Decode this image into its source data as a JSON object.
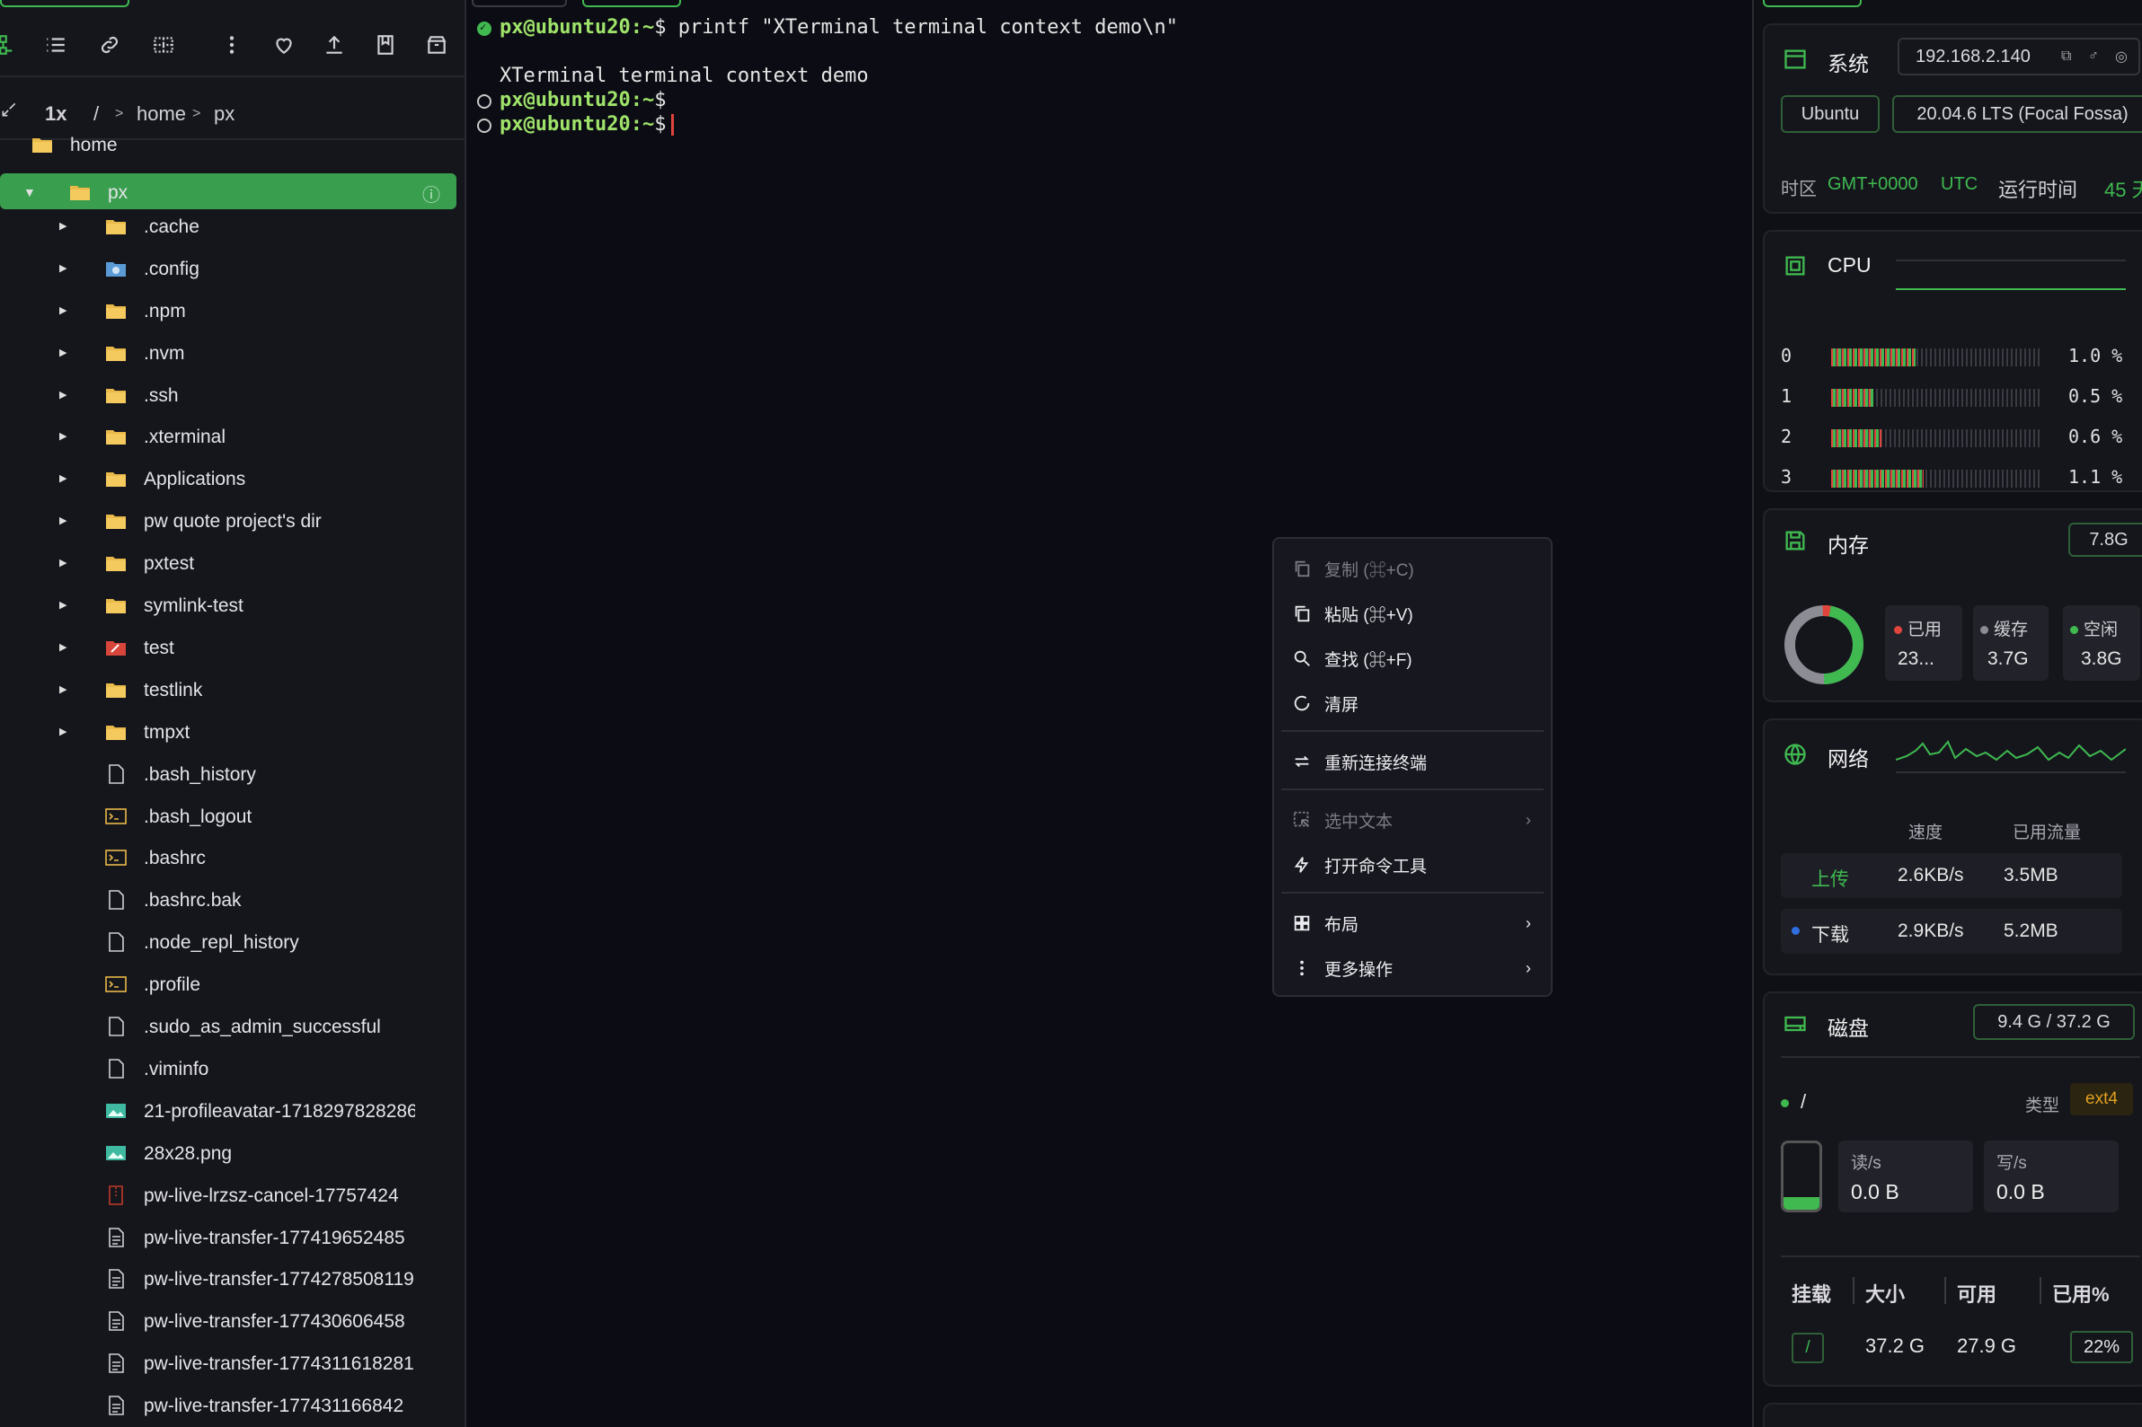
{
  "sidebar": {
    "path": {
      "zoom": "1x",
      "root": "/",
      "sep": ">",
      "seg1": "home",
      "seg2": "px"
    },
    "tree": [
      {
        "label": "home",
        "type": "folder"
      },
      {
        "label": "px",
        "type": "folder",
        "selected": true
      },
      {
        "label": ".cache",
        "type": "folder"
      },
      {
        "label": ".config",
        "type": "folder-gear"
      },
      {
        "label": ".npm",
        "type": "folder"
      },
      {
        "label": ".nvm",
        "type": "folder"
      },
      {
        "label": ".ssh",
        "type": "folder"
      },
      {
        "label": ".xterminal",
        "type": "folder"
      },
      {
        "label": "Applications",
        "type": "folder"
      },
      {
        "label": "pw quote project's dir",
        "type": "folder"
      },
      {
        "label": "pxtest",
        "type": "folder"
      },
      {
        "label": "symlink-test",
        "type": "folder"
      },
      {
        "label": "test",
        "type": "folder-red"
      },
      {
        "label": "testlink",
        "type": "folder"
      },
      {
        "label": "tmpxt",
        "type": "folder"
      },
      {
        "label": ".bash_history",
        "type": "file"
      },
      {
        "label": ".bash_logout",
        "type": "script"
      },
      {
        "label": ".bashrc",
        "type": "script"
      },
      {
        "label": ".bashrc.bak",
        "type": "file"
      },
      {
        "label": ".node_repl_history",
        "type": "file"
      },
      {
        "label": ".profile",
        "type": "script"
      },
      {
        "label": ".sudo_as_admin_successful",
        "type": "file"
      },
      {
        "label": ".viminfo",
        "type": "file"
      },
      {
        "label": "21-profileavatar-1718297828286",
        "type": "image"
      },
      {
        "label": "28x28.png",
        "type": "image"
      },
      {
        "label": "pw-live-lrzsz-cancel-17757424",
        "type": "archive"
      },
      {
        "label": "pw-live-transfer-177419652485",
        "type": "doc"
      },
      {
        "label": "pw-live-transfer-1774278508119",
        "type": "doc"
      },
      {
        "label": "pw-live-transfer-177430606458",
        "type": "doc"
      },
      {
        "label": "pw-live-transfer-1774311618281",
        "type": "doc"
      },
      {
        "label": "pw-live-transfer-177431166842",
        "type": "doc"
      }
    ]
  },
  "terminal": {
    "prompt": "px@ubuntu20",
    "path": ":~",
    "dollar": "$",
    "cmd1": " printf \"XTerminal terminal context demo\\n\"",
    "output1": "XTerminal terminal context demo"
  },
  "context_menu": {
    "copy": "复制 (⌘+C)",
    "paste": "粘贴 (⌘+V)",
    "find": "查找 (⌘+F)",
    "clear": "清屏",
    "reconnect": "重新连接终端",
    "selected_text": "选中文本",
    "open_cmd_tool": "打开命令工具",
    "layout": "布局",
    "more_actions": "更多操作"
  },
  "system": {
    "title": "系统",
    "ip": "192.168.2.140",
    "os": "Ubuntu",
    "version": "20.04.6 LTS (Focal Fossa)",
    "tz_label": "时区",
    "tz_value": "GMT+0000",
    "tz_name": "UTC",
    "uptime_label": "运行时间",
    "uptime_value": "45 天"
  },
  "cpu": {
    "title": "CPU",
    "cores": [
      {
        "id": "0",
        "usage": "1.0 %",
        "fraction": 0.01
      },
      {
        "id": "1",
        "usage": "0.5 %",
        "fraction": 0.005
      },
      {
        "id": "2",
        "usage": "0.6 %",
        "fraction": 0.006
      },
      {
        "id": "3",
        "usage": "1.1 %",
        "fraction": 0.011
      }
    ]
  },
  "memory": {
    "title": "内存",
    "total": "7.8G",
    "used_label": "已用",
    "used_value": "23...",
    "cache_label": "缓存",
    "cache_value": "3.7G",
    "free_label": "空闲",
    "free_value": "3.8G"
  },
  "network": {
    "title": "网络",
    "speed_header": "速度",
    "traffic_header": "已用流量",
    "up_label": "上传",
    "up_speed": "2.6KB/s",
    "up_total": "3.5MB",
    "down_label": "下载",
    "down_speed": "2.9KB/s",
    "down_total": "5.2MB"
  },
  "disk": {
    "title": "磁盘",
    "summary": "9.4 G / 37.2 G",
    "mount": "/",
    "type_label": "类型",
    "type_value": "ext4",
    "read_label": "读/s",
    "read_value": "0.0 B",
    "write_label": "写/s",
    "write_value": "0.0 B",
    "table_headers": [
      "挂载",
      "大小",
      "可用",
      "已用%"
    ],
    "row": {
      "mount": "/",
      "size": "37.2 G",
      "avail": "27.9 G",
      "used": "22%"
    }
  },
  "colors": {
    "accent": "#3fb950",
    "danger": "#e0443c",
    "bg": "#0c0d14"
  }
}
